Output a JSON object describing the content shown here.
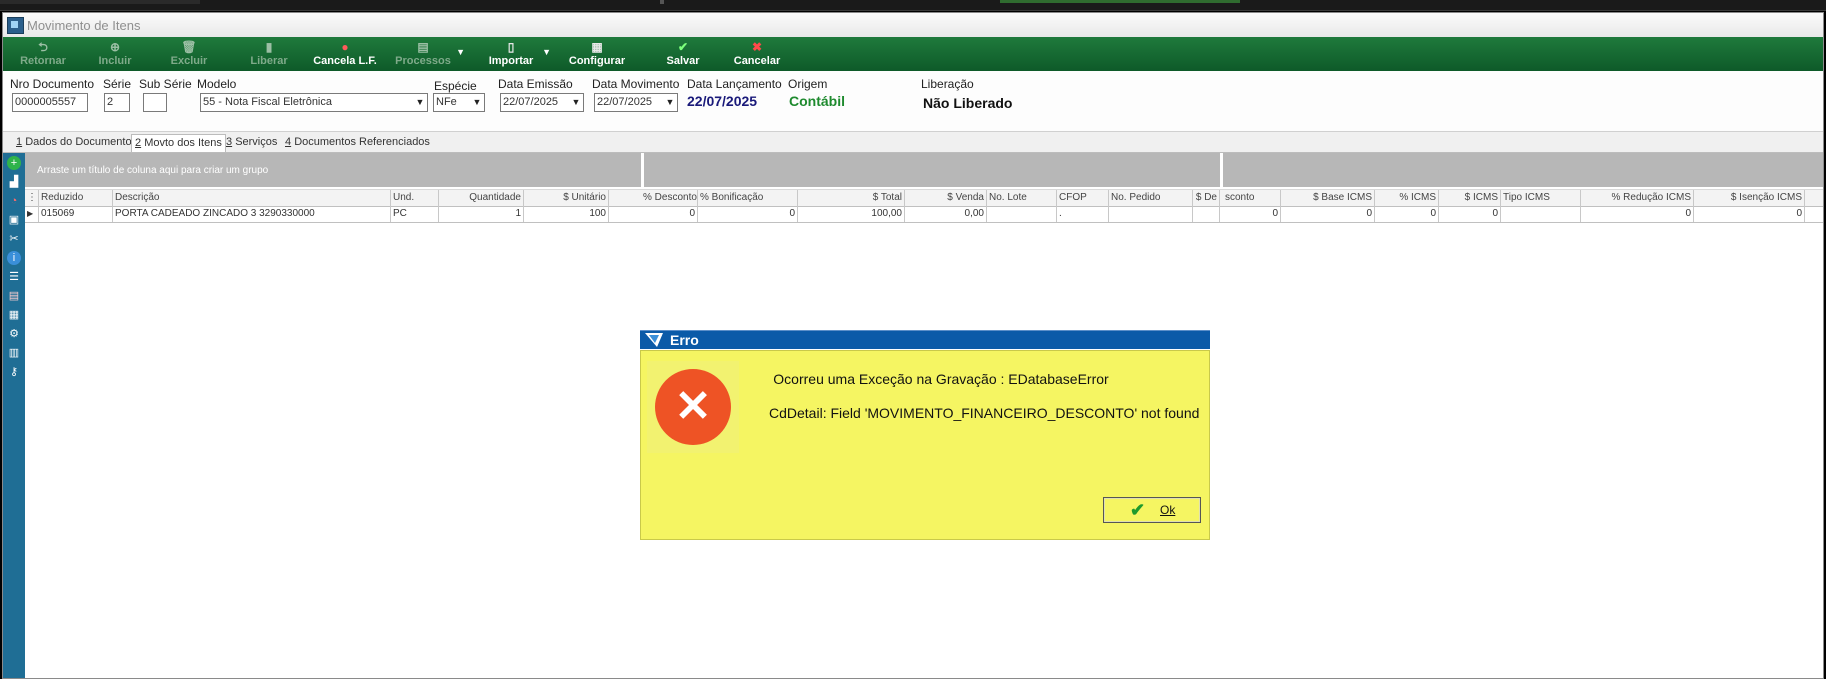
{
  "window": {
    "title": "Movimento de Itens"
  },
  "toolbar": {
    "retornar": "Retornar",
    "incluir": "Incluir",
    "excluir": "Excluir",
    "liberar": "Liberar",
    "cancela_lf": "Cancela L.F.",
    "processos": "Processos",
    "importar": "Importar",
    "configurar": "Configurar",
    "salvar": "Salvar",
    "cancelar": "Cancelar"
  },
  "header": {
    "nro_documento_label": "Nro Documento",
    "nro_documento_value": "0000005557",
    "serie_label": "Série",
    "serie_value": "2",
    "sub_serie_label": "Sub Série",
    "sub_serie_value": "",
    "modelo_label": "Modelo",
    "modelo_value": "55 - Nota Fiscal Eletrônica",
    "especie_label": "Espécie",
    "especie_value": "NFe",
    "data_emissao_label": "Data Emissão",
    "data_emissao_value": "22/07/2025",
    "data_movimento_label": "Data Movimento",
    "data_movimento_value": "22/07/2025",
    "data_lancamento_label": "Data Lançamento",
    "data_lancamento_value": "22/07/2025",
    "origem_label": "Origem",
    "origem_value": "Contábil",
    "liberacao_label": "Liberação",
    "liberacao_value": "Não Liberado"
  },
  "tabs": [
    {
      "num": "1",
      "label": "Dados do Documento"
    },
    {
      "num": "2",
      "label": "Movto dos Itens"
    },
    {
      "num": "3",
      "label": "Serviços"
    },
    {
      "num": "4",
      "label": "Documentos Referenciados"
    }
  ],
  "grid": {
    "group_hint": "Arraste um título de coluna aqui para criar um grupo",
    "columns": [
      "Reduzido",
      "Descrição",
      "Und.",
      "Quantidade",
      "$ Unitário",
      "% Desconto",
      "% Bonificação",
      "$ Total",
      "$ Venda",
      "No. Lote",
      "CFOP",
      "No. Pedido",
      "$ De",
      "sconto",
      "$ Base ICMS",
      "% ICMS",
      "$ ICMS",
      "Tipo ICMS",
      "% Redução ICMS",
      "$ Isenção ICMS"
    ],
    "row": [
      "015069",
      "PORTA CADEADO ZINCADO 3 3290330000",
      "PC",
      "1",
      "100",
      "0",
      "0",
      "100,00",
      "0,00",
      "",
      ".",
      "",
      "",
      "0",
      "0",
      "0",
      "0",
      "",
      "0",
      "0"
    ]
  },
  "dialog": {
    "title": "Erro",
    "message1": "Ocorreu uma Exceção na Gravação : EDatabaseError",
    "message2": "CdDetail: Field 'MOVIMENTO_FINANCEIRO_DESCONTO' not found",
    "ok_label": "Ok"
  },
  "colors": {
    "toolbar_green": "#0e5a29",
    "sidebar_blue": "#1f6e95",
    "dialog_yellow": "#f5f562",
    "error_red": "#ee5325",
    "dialog_title_blue": "#0b5aa8"
  }
}
